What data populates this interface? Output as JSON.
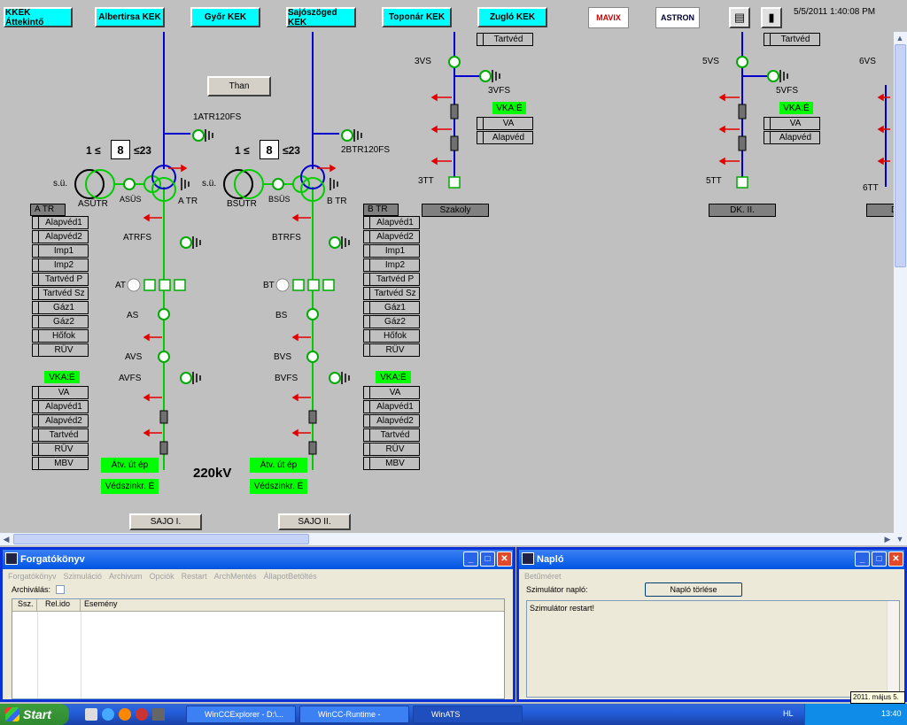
{
  "nav": {
    "buttons": [
      "KKEK Áttekintő",
      "Albertirsa KEK",
      "Győr KEK",
      "Sajószöged KEK",
      "Toponár KEK",
      "Zugló KEK"
    ],
    "datetime": "5/5/2011 1:40:08 PM",
    "logo_mavix": "MAVIX",
    "logo_astron": "ASTRON"
  },
  "diagram": {
    "than_button": "Than",
    "voltage_label": "220kV",
    "tap_a": {
      "min": "1",
      "value": "8",
      "max": "23"
    },
    "tap_b": {
      "min": "1",
      "value": "8",
      "max": "23"
    },
    "labels": {
      "1atr120fs": "1ATR120FS",
      "2btr120fs": "2BTR120FS",
      "su_a": "s.ü.",
      "su_b": "s.ü.",
      "asutr": "ASÜTR",
      "bsutr": "BSÜTR",
      "asus": "ASÜS",
      "bsus": "BSÜS",
      "atr": "A TR",
      "btr": "B TR",
      "atrfs": "ATRFS",
      "btrfs": "BTRFS",
      "at": "AT",
      "bt": "BT",
      "as": "AS",
      "bs": "BS",
      "avs": "AVS",
      "bvs": "BVS",
      "avfs": "AVFS",
      "bvfs": "BVFS",
      "3vs": "3VS",
      "3vfs": "3VFS",
      "3tt": "3TT",
      "5vs": "5VS",
      "5vfs": "5VFS",
      "5tt": "5TT",
      "6vs": "6VS",
      "6tt": "6TT"
    },
    "atr_stack": {
      "title": "A TR",
      "items": [
        "Alapvéd1",
        "Alapvéd2",
        "Imp1",
        "Imp2",
        "Tartvéd P",
        "Tartvéd Sz",
        "Gáz1",
        "Gáz2",
        "Hőfok",
        "RÜV"
      ]
    },
    "btr_stack": {
      "title": "B TR",
      "items": [
        "Alapvéd1",
        "Alapvéd2",
        "Imp1",
        "Imp2",
        "Tartvéd P",
        "Tartvéd Sz",
        "Gáz1",
        "Gáz2",
        "Hőfok",
        "RÜV"
      ]
    },
    "vka_a": {
      "title": "VKA:É",
      "items": [
        "VA",
        "Alapvéd1",
        "Alapvéd2",
        "Tartvéd",
        "RÜV",
        "MBV"
      ]
    },
    "vka_b": {
      "title": "VKA:É",
      "items": [
        "VA",
        "Alapvéd1",
        "Alapvéd2",
        "Tartvéd",
        "RÜV",
        "MBV"
      ]
    },
    "vka_3": {
      "title": "VKA:É",
      "items": [
        "VA",
        "Alapvéd"
      ]
    },
    "vka_5": {
      "title": "VKA:É",
      "items": [
        "VA",
        "Alapvéd"
      ]
    },
    "tartved_top3": "Tartvéd",
    "tartved_top5": "Tartvéd",
    "green_a1": "Átv. út ép",
    "green_a2": "Védszinkr. É",
    "green_b1": "Átv. út ép",
    "green_b2": "Védszinkr. É",
    "bay_szakoly": "Szakoly",
    "bay_dk": "DK. II.",
    "bay_d": "D",
    "sajo1": "SAJO I.",
    "sajo2": "SAJO II."
  },
  "forgatokonyv": {
    "title": "Forgatókönyv",
    "menu": [
      "Forgatókönyv",
      "Szimuláció",
      "Archivum",
      "Opciók",
      "Restart",
      "ArchMentés",
      "ÁllapotBetöltés"
    ],
    "archivalas_label": "Archiválás:",
    "columns": [
      "Ssz.",
      "Rel.ido",
      "Esemény"
    ]
  },
  "naplo": {
    "title": "Napló",
    "menu": [
      "Betűméret"
    ],
    "sim_label": "Szimulátor napló:",
    "clear_button": "Napló törlése",
    "log_text": "Szimulátor restart!"
  },
  "taskbar": {
    "start": "Start",
    "items": [
      "WinCCExplorer - D:\\...",
      "WinCC-Runtime -",
      "WinATS"
    ],
    "lang": "HL",
    "clock": "13:40",
    "tooltip": "2011. május 5."
  }
}
